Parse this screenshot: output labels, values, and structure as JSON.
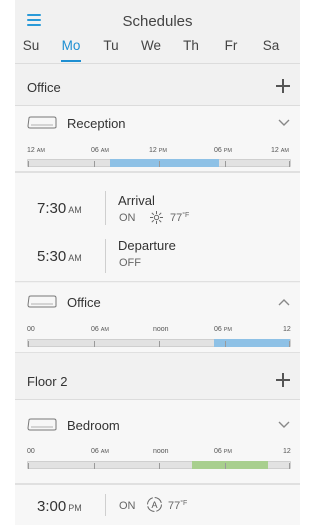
{
  "header": {
    "title": "Schedules",
    "days": [
      "Su",
      "Mo",
      "Tu",
      "We",
      "Th",
      "Fr",
      "Sa"
    ],
    "active_day": "Mo"
  },
  "groups": [
    {
      "label": "Office",
      "units": [
        {
          "name": "Reception",
          "expanded": true,
          "ticks": [
            {
              "value": "12",
              "unit": "AM"
            },
            {
              "value": "06",
              "unit": "AM"
            },
            {
              "value": "12",
              "unit": "PM"
            },
            {
              "value": "06",
              "unit": "PM"
            },
            {
              "value": "12",
              "unit": "AM"
            }
          ],
          "active_from_hour": 7.5,
          "active_to_hour": 17.5,
          "bar_color": "#8ec1e6",
          "events": [
            {
              "time": "7:30",
              "ampm": "AM",
              "name": "Arrival",
              "state": "ON",
              "mode": "cool",
              "temp": "77",
              "unit": "°F"
            },
            {
              "time": "5:30",
              "ampm": "AM",
              "name": "Departure",
              "state": "OFF"
            }
          ]
        },
        {
          "name": "Office",
          "expanded": false,
          "ticks": [
            {
              "value": "00",
              "unit": ""
            },
            {
              "value": "06",
              "unit": "AM"
            },
            {
              "value": "noon",
              "unit": ""
            },
            {
              "value": "06",
              "unit": "PM"
            },
            {
              "value": "12",
              "unit": ""
            }
          ],
          "active_from_hour": 17,
          "active_to_hour": 24,
          "bar_color": "#8ec1e6"
        }
      ]
    },
    {
      "label": "Floor 2",
      "units": [
        {
          "name": "Bedroom",
          "expanded": true,
          "ticks": [
            {
              "value": "00",
              "unit": ""
            },
            {
              "value": "06",
              "unit": "AM"
            },
            {
              "value": "noon",
              "unit": ""
            },
            {
              "value": "06",
              "unit": "PM"
            },
            {
              "value": "12",
              "unit": ""
            }
          ],
          "active_from_hour": 15,
          "active_to_hour": 22,
          "bar_color": "#a8cf8e",
          "events": [
            {
              "time": "3:00",
              "ampm": "PM",
              "state": "ON",
              "mode": "auto",
              "mode_letter": "A",
              "temp": "77",
              "unit": "°F"
            }
          ]
        }
      ]
    }
  ],
  "colors": {
    "accent": "#1e8fd2",
    "cool_bar": "#8ec1e6",
    "heat_bar": "#a8cf8e"
  }
}
